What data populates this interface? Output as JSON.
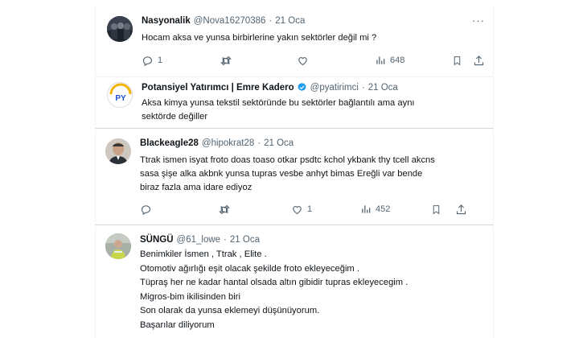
{
  "tweets": [
    {
      "name": "Nasyonalik",
      "handle": "@Nova16270386",
      "dot": "·",
      "time": "21 Oca",
      "more": "···",
      "lines": [
        "Hocam aksa ve yunsa birbirlerine yakın sektörler değil mi ?"
      ],
      "reply_count": "1",
      "views": "648"
    },
    {
      "name": "Potansiyel Yatırımcı | Emre Kadero",
      "handle": "@pyatirimci",
      "dot": "·",
      "time": "21 Oca",
      "verified": true,
      "lines": [
        "Aksa kimya yunsa tekstil sektöründe bu sektörler bağlantılı ama aynı",
        "sektörde değiller"
      ]
    },
    {
      "name": "Blackeagle28",
      "handle": "@hipokrat28",
      "dot": "·",
      "time": "21 Oca",
      "lines": [
        "Ttrak ismen isyat froto doas toaso otkar psdtc kchol ykbank thy tcell akcns",
        "sasa şişe alka akbnk yunsa tupras vesbe anhyt bimas Ereğli var bende",
        "biraz fazla ama idare ediyoz"
      ],
      "like_count": "1",
      "views": "452"
    },
    {
      "name": "SÜNGÜ",
      "handle": "@61_lowe",
      "dot": "·",
      "time": "21 Oca",
      "lines": [
        "Benimkiler İsmen , Ttrak , Elite .",
        "Otomotiv ağırlığı eşit olacak şekilde froto ekleyeceğim .",
        "Tüpraş her ne kadar hantal olsada altın gibidir tupras ekleyecegim .",
        "Migros-bim ikilisinden biri",
        "Son olarak da yunsa eklemeyi düşünüyorum.",
        "Başarılar diliyorum"
      ]
    }
  ],
  "colors": {
    "text": "#0f1419",
    "secondary": "#536471",
    "verified": "#1d9bf0",
    "border": "#eff3f4"
  },
  "icons": [
    "reply-icon",
    "retweet-icon",
    "like-icon",
    "views-icon",
    "bookmark-icon",
    "share-icon",
    "more-icon",
    "verified-icon"
  ]
}
